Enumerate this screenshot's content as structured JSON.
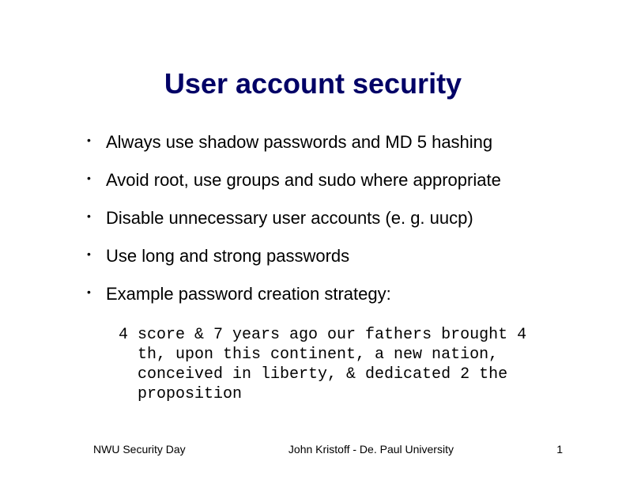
{
  "slide": {
    "title": "User account security",
    "bullets": [
      "Always use shadow passwords and MD 5 hashing",
      "Avoid root, use groups and sudo where appropriate",
      "Disable unnecessary user accounts (e. g. uucp)",
      "Use long and strong passwords",
      "Example password creation strategy:"
    ],
    "example": "4 score & 7 years ago our fathers brought 4 th, upon this continent, a new nation, conceived in liberty, & dedicated 2 the proposition",
    "footer": {
      "left": "NWU Security Day",
      "center": "John Kristoff - De. Paul University",
      "page": "1"
    }
  }
}
